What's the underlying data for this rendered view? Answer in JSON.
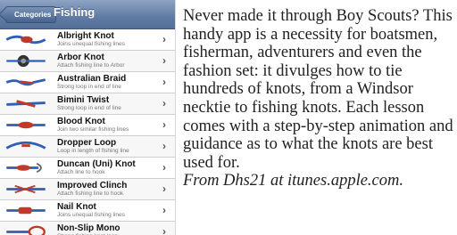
{
  "nav": {
    "back_label": "Categories",
    "title": "Fishing"
  },
  "items": [
    {
      "title": "Albright Knot",
      "subtitle": "Joins unequal fishing lines",
      "icon": "knot-thumbnail-icon"
    },
    {
      "title": "Arbor Knot",
      "subtitle": "Attach fishing line to Arbor",
      "icon": "knot-thumbnail-icon"
    },
    {
      "title": "Australian Braid",
      "subtitle": "Strong loop in end of line",
      "icon": "knot-thumbnail-icon"
    },
    {
      "title": "Bimini Twist",
      "subtitle": "Strong loop in end of line",
      "icon": "knot-thumbnail-icon"
    },
    {
      "title": "Blood Knot",
      "subtitle": "Join two similar fishing lines",
      "icon": "knot-thumbnail-icon"
    },
    {
      "title": "Dropper Loop",
      "subtitle": "Loop in length of fishing line",
      "icon": "knot-thumbnail-icon"
    },
    {
      "title": "Duncan (Uni) Knot",
      "subtitle": "Attach line to hook",
      "icon": "knot-thumbnail-icon"
    },
    {
      "title": "Improved Clinch",
      "subtitle": "Attach fishing line to hook",
      "icon": "knot-thumbnail-icon"
    },
    {
      "title": "Nail Knot",
      "subtitle": "Joins unequal fishing lines",
      "icon": "knot-thumbnail-icon"
    },
    {
      "title": "Non-Slip Mono",
      "subtitle": "Strong fishing knot loop",
      "icon": "knot-thumbnail-icon"
    }
  ],
  "description": {
    "body": "Never made it through Boy Scouts? This handy app is a necessity for boatsmen, fisherman, adventurers and even the fashion set: it divulges how to tie hundreds of knots, from a Windsor necktie to fishing knots. Each lesson comes with a step-by-step animation and guidance as to what the knots are best used for.",
    "source": "From Dhs21 at itunes.apple.com."
  },
  "colors": {
    "navbar": "#5f7ba4",
    "rope_blue": "#2f5fb0",
    "rope_red": "#c0392b"
  }
}
